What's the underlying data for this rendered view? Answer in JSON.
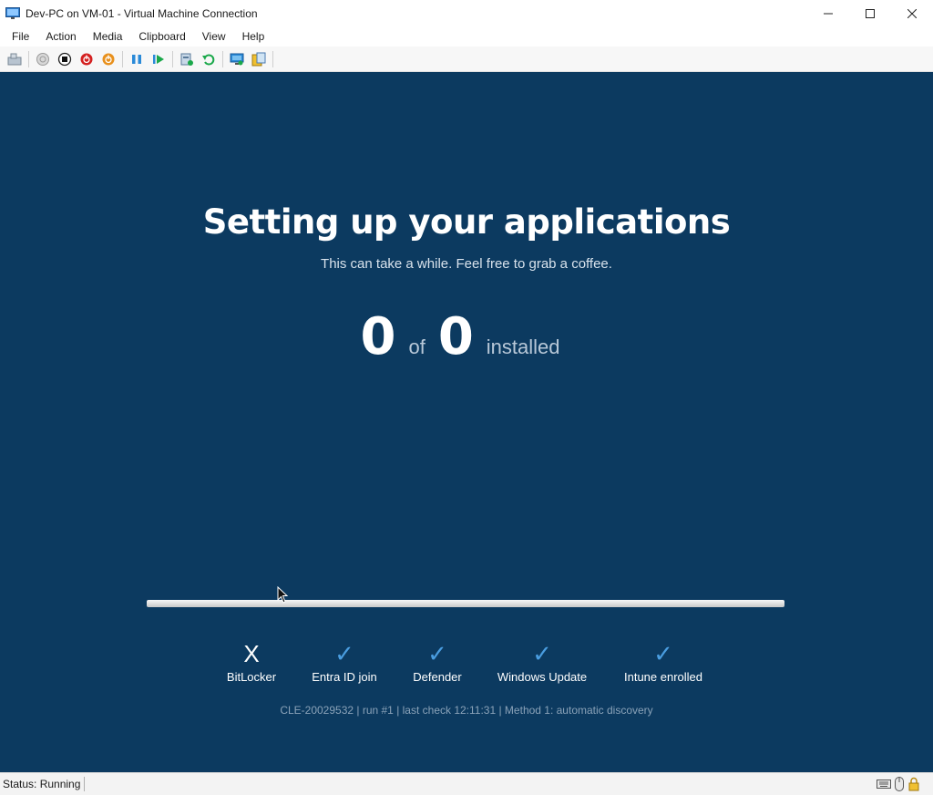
{
  "window": {
    "title": "Dev-PC on VM-01 - Virtual Machine Connection"
  },
  "menu": [
    "File",
    "Action",
    "Media",
    "Clipboard",
    "View",
    "Help"
  ],
  "toolbar": {
    "buttons": [
      "ctrl-alt-del-icon",
      "start-icon",
      "turn-off-icon",
      "shutdown-icon",
      "save-icon",
      "pause-icon",
      "resume-icon",
      "checkpoint-icon",
      "revert-icon",
      "enhanced-session-icon",
      "share-icon"
    ]
  },
  "vm": {
    "heading": "Setting up your applications",
    "subheading": "This can take a while. Feel free to grab a coffee.",
    "installed_count": "0",
    "of_label": "of",
    "total_count": "0",
    "installed_label": "installed",
    "progress_fraction": 1.0,
    "checks": [
      {
        "mark": "X",
        "label": "BitLocker",
        "status": "fail"
      },
      {
        "mark": "✓",
        "label": "Entra ID join",
        "status": "ok"
      },
      {
        "mark": "✓",
        "label": "Defender",
        "status": "ok"
      },
      {
        "mark": "✓",
        "label": "Windows Update",
        "status": "ok"
      },
      {
        "mark": "✓",
        "label": "Intune enrolled",
        "status": "ok"
      }
    ],
    "footer": "CLE-20029532 | run #1 | last check 12:11:31 | Method 1: automatic discovery"
  },
  "status": {
    "text": "Status: Running"
  },
  "colors": {
    "vm_background": "#0c3a60",
    "check_ok": "#4a9de0"
  }
}
